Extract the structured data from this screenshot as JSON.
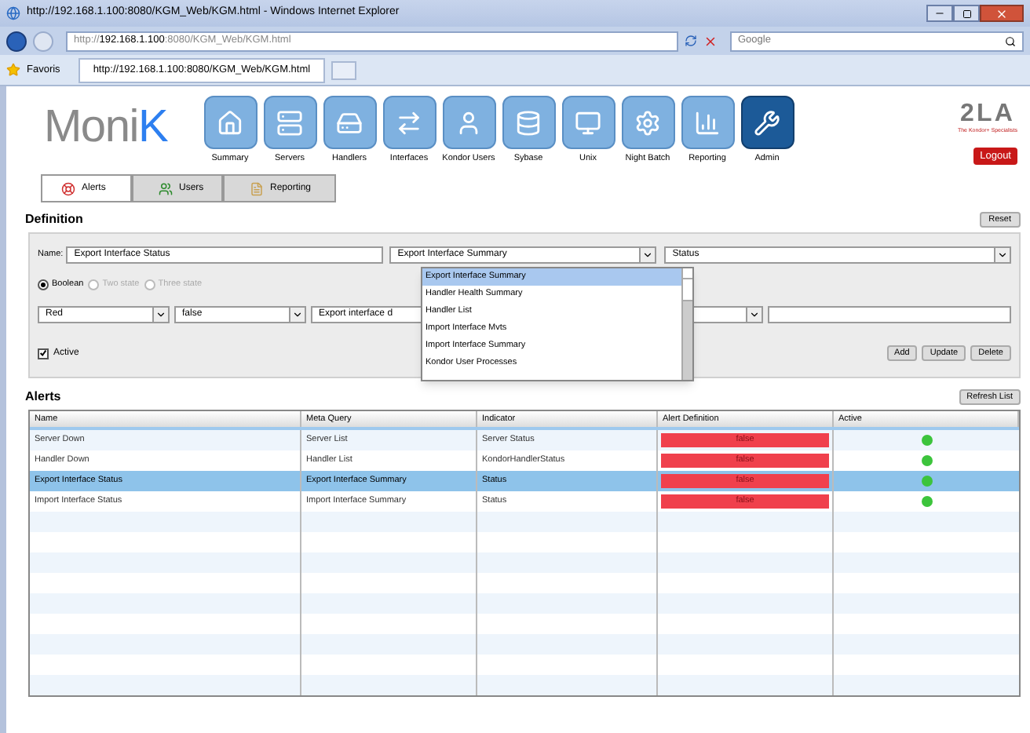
{
  "window": {
    "title": "http://192.168.1.100:8080/KGM_Web/KGM.html - Windows Internet Explorer"
  },
  "address": {
    "prefix": "http://",
    "host": "192.168.1.100",
    "rest": ":8080/KGM_Web/KGM.html"
  },
  "search": {
    "placeholder": "Google"
  },
  "favorites": "Favoris",
  "browser_tab": "http://192.168.1.100:8080/KGM_Web/KGM.html",
  "logo": {
    "main": "Moni",
    "accent": "K"
  },
  "nav": [
    {
      "label": "Summary",
      "selected": false
    },
    {
      "label": "Servers",
      "selected": false
    },
    {
      "label": "Handlers",
      "selected": false
    },
    {
      "label": "Interfaces",
      "selected": false
    },
    {
      "label": "Kondor Users",
      "selected": false
    },
    {
      "label": "Sybase",
      "selected": false
    },
    {
      "label": "Unix",
      "selected": false
    },
    {
      "label": "Night Batch",
      "selected": false
    },
    {
      "label": "Reporting",
      "selected": false
    },
    {
      "label": "Admin",
      "selected": true
    }
  ],
  "brand": {
    "name": "2LA",
    "tagline": "The Kondor+ Specialists"
  },
  "logout": "Logout",
  "subtabs": [
    {
      "label": "Alerts",
      "selected": true
    },
    {
      "label": "Users",
      "selected": false
    },
    {
      "label": "Reporting",
      "selected": false
    }
  ],
  "definition": {
    "heading": "Definition",
    "reset": "Reset",
    "name_label": "Name:",
    "name_value": "Export Interface Status",
    "meta_query": "Export Interface Summary",
    "indicator": "Status",
    "modes": [
      {
        "label": "Boolean",
        "selected": true,
        "disabled": false
      },
      {
        "label": "Two state",
        "selected": false,
        "disabled": true
      },
      {
        "label": "Three state",
        "selected": false,
        "disabled": true
      }
    ],
    "severity": "Red",
    "value": "false",
    "description": "Export interface d",
    "active": {
      "label": "Active",
      "checked": true
    },
    "buttons": [
      "Add",
      "Update",
      "Delete"
    ]
  },
  "dropdown": {
    "items": [
      {
        "label": "Export Interface Summary",
        "selected": true
      },
      {
        "label": "Handler Health Summary",
        "selected": false
      },
      {
        "label": "Handler List",
        "selected": false
      },
      {
        "label": "Import Interface Mvts",
        "selected": false
      },
      {
        "label": "Import Interface Summary",
        "selected": false
      },
      {
        "label": "Kondor User Processes",
        "selected": false
      }
    ]
  },
  "alerts": {
    "heading": "Alerts",
    "refresh": "Refresh List",
    "columns": [
      "Name",
      "Meta Query",
      "Indicator",
      "Alert Definition",
      "Active"
    ],
    "rows": [
      {
        "name": "Server Down",
        "meta_query": "Server List",
        "indicator": "Server Status",
        "definition": "false",
        "active": true,
        "selected": false
      },
      {
        "name": "Handler Down",
        "meta_query": "Handler List",
        "indicator": "KondorHandlerStatus",
        "definition": "false",
        "active": true,
        "selected": false
      },
      {
        "name": "Export Interface Status",
        "meta_query": "Export Interface Summary",
        "indicator": "Status",
        "definition": "false",
        "active": true,
        "selected": true
      },
      {
        "name": "Import Interface Status",
        "meta_query": "Import Interface Summary",
        "indicator": "Status",
        "definition": "false",
        "active": true,
        "selected": false
      }
    ]
  }
}
